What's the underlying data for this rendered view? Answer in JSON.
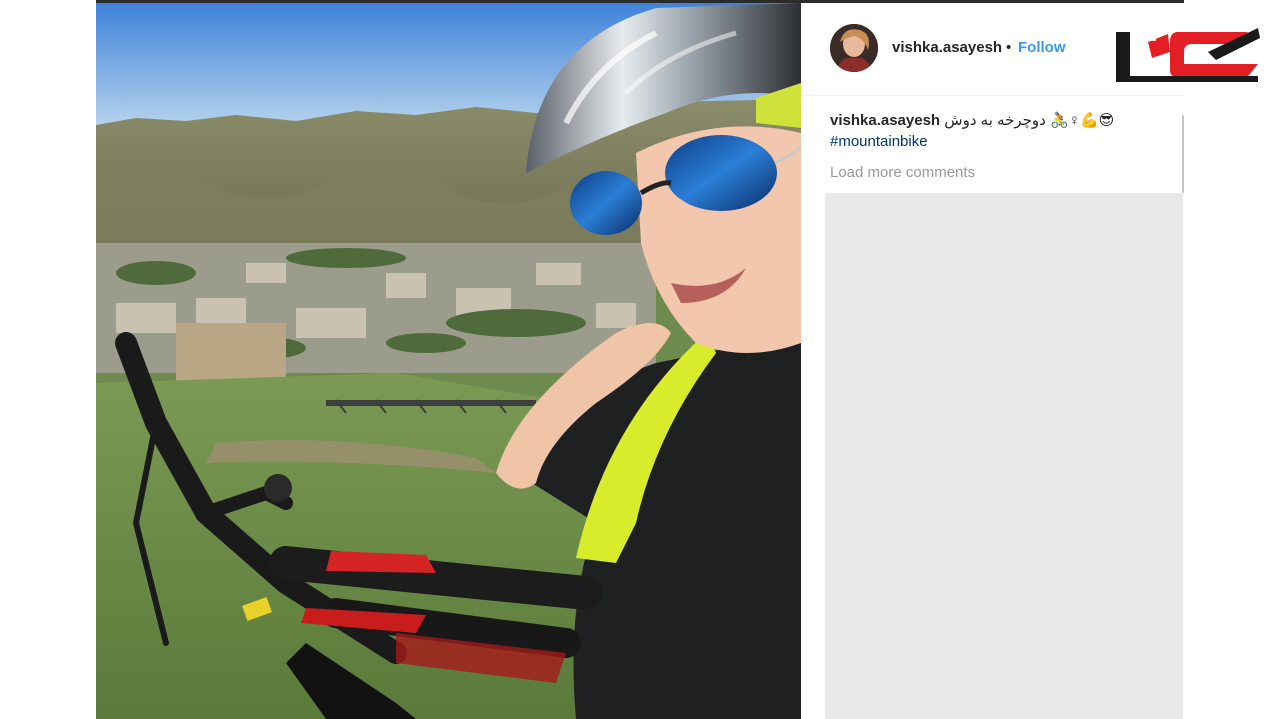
{
  "post": {
    "username": "vishka.asayesh",
    "separator": "•",
    "follow_label": "Follow",
    "caption_user": "vishka.asayesh",
    "caption_text": "دوچرخه به دوش",
    "caption_emojis": "🚴♀💪😎",
    "hashtag": "#mountainbike",
    "load_more_label": "Load more comments"
  },
  "colors": {
    "follow_blue": "#3897f0",
    "hashtag_blue": "#003569",
    "logo_red": "#e31e24",
    "logo_black": "#1a1a1a"
  },
  "icons": {
    "avatar": "profile-avatar",
    "logo": "news-site-logo"
  }
}
